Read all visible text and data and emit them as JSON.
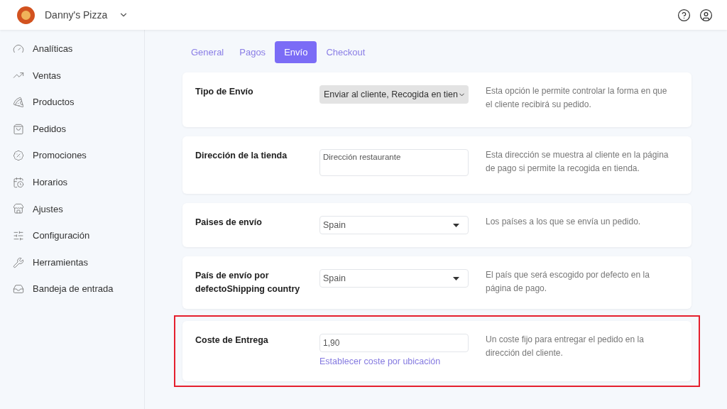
{
  "header": {
    "store_name": "Danny's Pizza"
  },
  "sidebar": {
    "items": [
      {
        "label": "Analíticas"
      },
      {
        "label": "Ventas"
      },
      {
        "label": "Productos"
      },
      {
        "label": "Pedidos"
      },
      {
        "label": "Promociones"
      },
      {
        "label": "Horarios"
      },
      {
        "label": "Ajustes"
      },
      {
        "label": "Configuración"
      },
      {
        "label": "Herramientas"
      },
      {
        "label": "Bandeja de entrada"
      }
    ]
  },
  "tabs": [
    {
      "label": "General",
      "selected": false
    },
    {
      "label": "Pagos",
      "selected": false
    },
    {
      "label": "Envío",
      "selected": true
    },
    {
      "label": "Checkout",
      "selected": false
    }
  ],
  "settings": [
    {
      "kind": "grey-select",
      "label": "Tipo de Envío",
      "value": "Enviar al cliente, Recogida en tien",
      "description": "Esta opción le permite controlar la forma en que el cliente recibirá su pedido.",
      "highlighted": false
    },
    {
      "kind": "textarea",
      "label": "Dirección de la tienda",
      "placeholder": "Dirección restaurante",
      "description": "Esta dirección se muestra al cliente en la página de pago si permite la recogida en tienda.",
      "highlighted": false
    },
    {
      "kind": "select",
      "label": "Paises de envío",
      "value": "Spain",
      "description": "Los países a los que se envía un pedido.",
      "highlighted": false
    },
    {
      "kind": "select",
      "label": "País de envío por defectoShipping country",
      "value": "Spain",
      "description": "El país que será escogido por defecto en la página de pago.",
      "highlighted": false
    },
    {
      "kind": "input",
      "label": "Coste de Entrega",
      "value": "1,90",
      "link": "Establecer coste por ubicación",
      "description": "Un coste fijo para entregar el pedido en la dirección del cliente.",
      "highlighted": true
    }
  ]
}
